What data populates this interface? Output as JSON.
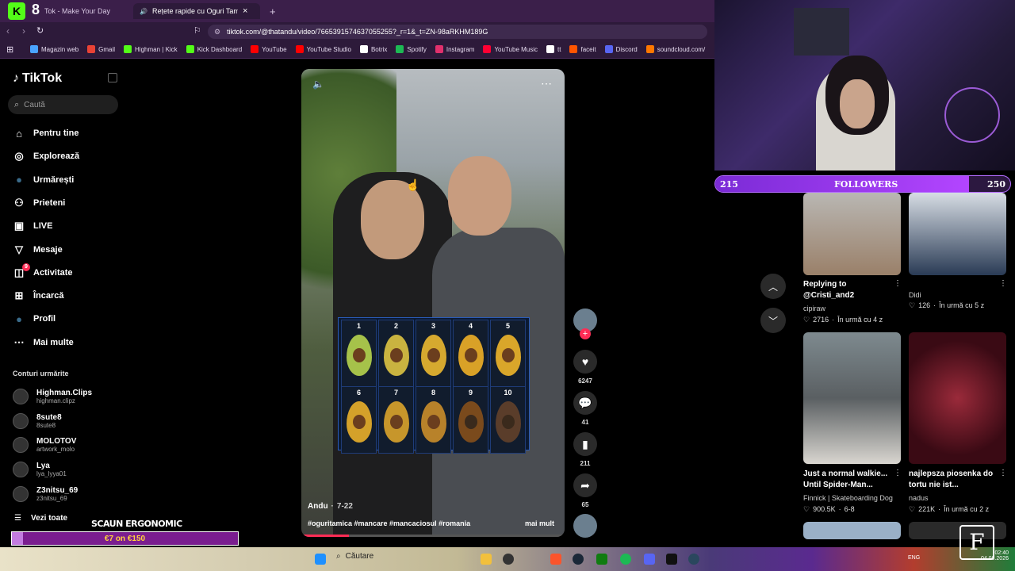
{
  "browser": {
    "tabs": [
      {
        "label": "Tok - Make Your Day"
      },
      {
        "label": "Rețete rapide cu Oguri Tamic"
      }
    ],
    "tab_close": "×",
    "tab_add": "+",
    "url": "tiktok.com/@thatandu/video/7665391574637055255?_r=1&_t=ZN-98aRKHM189G",
    "bookmarks": [
      {
        "label": "Magazin web",
        "color": "#4aa3ff"
      },
      {
        "label": "Gmail",
        "color": "#e94235"
      },
      {
        "label": "Highman | Kick",
        "color": "#53fc18"
      },
      {
        "label": "Kick Dashboard",
        "color": "#53fc18"
      },
      {
        "label": "YouTube",
        "color": "#ff0000"
      },
      {
        "label": "YouTube Studio",
        "color": "#ff0000"
      },
      {
        "label": "Botrix",
        "color": "#ffffff"
      },
      {
        "label": "Spotify",
        "color": "#1db954"
      },
      {
        "label": "Instagram",
        "color": "#e1306c"
      },
      {
        "label": "YouTube Music",
        "color": "#ff0033"
      },
      {
        "label": "tt",
        "color": "#ffffff"
      },
      {
        "label": "faceit",
        "color": "#ff5500"
      },
      {
        "label": "Discord",
        "color": "#5865f2"
      },
      {
        "label": "soundcloud.com/",
        "color": "#ff7700"
      }
    ]
  },
  "sidebar": {
    "logo": "TikTok",
    "search_placeholder": "Caută",
    "nav": [
      {
        "label": "Pentru tine",
        "icon": "home-icon",
        "glyph": "⌂"
      },
      {
        "label": "Explorează",
        "icon": "compass-icon",
        "glyph": "◎"
      },
      {
        "label": "Urmărești",
        "icon": "following-avatar-icon",
        "glyph": "●"
      },
      {
        "label": "Prieteni",
        "icon": "friends-icon",
        "glyph": "⚇"
      },
      {
        "label": "LIVE",
        "icon": "live-icon",
        "glyph": "▣"
      },
      {
        "label": "Mesaje",
        "icon": "messages-icon",
        "glyph": "▽"
      },
      {
        "label": "Activitate",
        "icon": "activity-icon",
        "glyph": "◫",
        "badge": "9"
      },
      {
        "label": "Încarcă",
        "icon": "upload-icon",
        "glyph": "⊞"
      },
      {
        "label": "Profil",
        "icon": "profile-icon",
        "glyph": "●"
      },
      {
        "label": "Mai multe",
        "icon": "more-icon",
        "glyph": "⋯"
      }
    ],
    "following_title": "Conturi urmărite",
    "accounts": [
      {
        "name": "Highman.Clips",
        "handle": "highman.clipz"
      },
      {
        "name": "8sute8",
        "handle": "8sute8"
      },
      {
        "name": "MOLOTOV",
        "handle": "artwork_molo"
      },
      {
        "name": "Lya",
        "handle": "lya_lyya01"
      },
      {
        "name": "Z3nitsu_69",
        "handle": "z3nitsu_69"
      }
    ],
    "see_all": "Vezi toate"
  },
  "video": {
    "author": "Andu",
    "date": "7-22",
    "hashtags": "#oguritamica #mancare #mancaciosul #romania",
    "more": "mai mult",
    "grid": [
      "1",
      "2",
      "3",
      "4",
      "5",
      "6",
      "7",
      "8",
      "9",
      "10"
    ],
    "progress": 0.18
  },
  "actions": {
    "likes": "6247",
    "comments": "41",
    "saves": "211",
    "shares": "65"
  },
  "overlay": {
    "followers_current": "215",
    "followers_label": "FOLLOWERS",
    "followers_goal": "250",
    "followers_progress": 0.86,
    "promo_title": "SCAUN ERGONOMIC",
    "promo_amount": "€7 on €150",
    "promo_progress": 0.05
  },
  "feed": [
    {
      "caption": "Replying to @Cristi_and2",
      "author": "cipiraw",
      "views": "2716",
      "time": "În urmă cu 4 z"
    },
    {
      "caption": "",
      "author": "Didi",
      "views": "126",
      "time": "În urmă cu 5 z"
    },
    {
      "caption": "Just a normal walkie... Until Spider-Man...",
      "author": "Finnick | Skateboarding Dog",
      "views": "900.5K",
      "time": "6-8"
    },
    {
      "caption": "najlepsza piosenka do tortu nie ist...",
      "author": "nadus",
      "views": "221K",
      "time": "În urmă cu 2 z"
    }
  ],
  "taskbar": {
    "search": "Căutare",
    "lang": "ENG",
    "time": "02:40",
    "date": "04.08.2026"
  }
}
